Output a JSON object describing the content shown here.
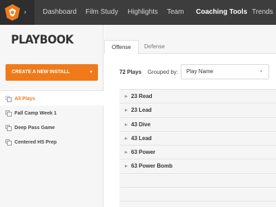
{
  "nav": {
    "logo_icon": "team-shield-logo-icon",
    "caret": "›",
    "items": [
      {
        "label": "Dashboard",
        "active": false
      },
      {
        "label": "Film Study",
        "active": false
      },
      {
        "label": "Highlights",
        "active": false
      },
      {
        "label": "Team",
        "active": false
      },
      {
        "label": "Coaching Tools",
        "active": true
      },
      {
        "label": "Trends",
        "active": false
      }
    ]
  },
  "sidebar": {
    "title": "PLAYBOOK",
    "create_button": "CREATE A NEW INSTALL",
    "create_arrow": "▼",
    "items": [
      {
        "label": "All Plays",
        "active": true
      },
      {
        "label": "Fall Camp Week 1",
        "active": false
      },
      {
        "label": "Deep Pass Game",
        "active": false
      },
      {
        "label": "Centered HS Prep",
        "active": false
      }
    ]
  },
  "main": {
    "tabs": [
      {
        "label": "Offense",
        "active": true
      },
      {
        "label": "Defense",
        "active": false
      }
    ],
    "count_label": "72 Plays",
    "grouped_label": "Grouped by:",
    "group_select": "Play Name",
    "select_arrow": "▼",
    "row_arrow": "▶",
    "plays": [
      "23 Read",
      "23 Lead",
      "43 Dive",
      "43 Lead",
      "63 Power",
      "63 Power Bomb"
    ]
  },
  "colors": {
    "accent": "#f07a1a",
    "nav_bg": "#3d3d3d",
    "panel_bg": "#f6f6f6"
  }
}
